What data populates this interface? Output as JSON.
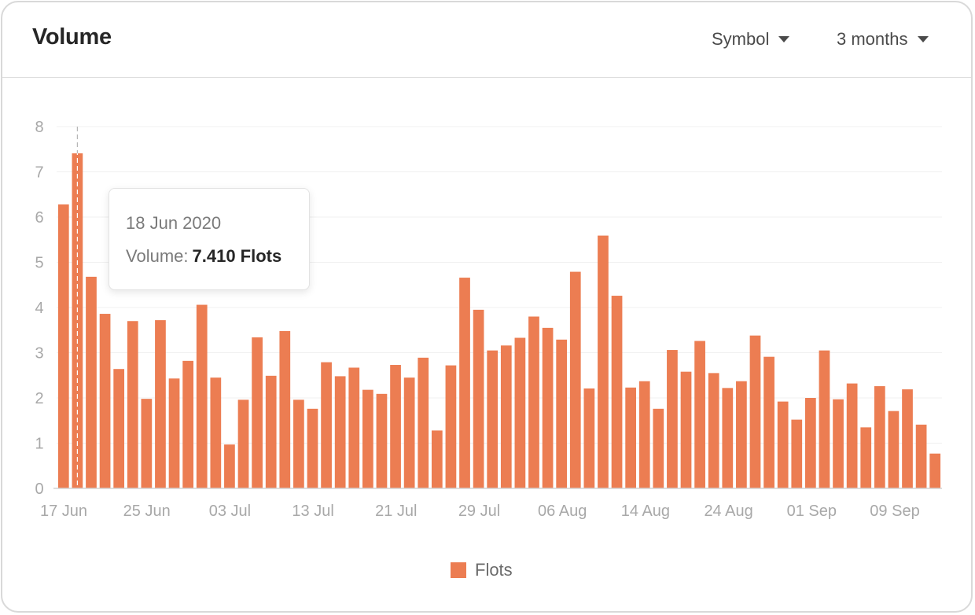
{
  "header": {
    "title": "Volume",
    "symbol_dropdown": "Symbol",
    "range_dropdown": "3 months"
  },
  "colors": {
    "bar": "#ec7d52",
    "grid": "#f0f0f0",
    "axis_text": "#a8a8a8"
  },
  "tooltip": {
    "date": "18 Jun 2020",
    "label": "Volume:",
    "value": "7.410 Flots"
  },
  "legend": {
    "label": "Flots"
  },
  "chart_data": {
    "type": "bar",
    "xlabel": "",
    "ylabel": "",
    "ylim": [
      0,
      8
    ],
    "y_ticks": [
      "0",
      "1",
      "2",
      "3",
      "4",
      "5",
      "6",
      "7",
      "8"
    ],
    "x_tick_labels": [
      "17 Jun",
      "25 Jun",
      "03 Jul",
      "13 Jul",
      "21 Jul",
      "29 Jul",
      "06 Aug",
      "14 Aug",
      "24 Aug",
      "01 Sep",
      "09 Sep"
    ],
    "grid": true,
    "legend_position": "bottom",
    "highlighted_bar": "18 Jun 2020",
    "series": [
      {
        "name": "Flots",
        "values": [
          6.28,
          7.41,
          4.68,
          3.86,
          2.64,
          3.7,
          1.98,
          3.72,
          2.43,
          2.82,
          4.06,
          2.45,
          0.97,
          1.96,
          3.34,
          2.49,
          3.48,
          1.96,
          1.76,
          2.79,
          2.48,
          2.67,
          2.18,
          2.09,
          2.73,
          2.45,
          2.89,
          1.28,
          2.72,
          4.66,
          3.95,
          3.05,
          3.16,
          3.33,
          3.8,
          3.55,
          3.29,
          4.79,
          2.21,
          5.59,
          4.26,
          2.23,
          2.37,
          1.76,
          3.06,
          2.58,
          3.26,
          2.55,
          2.22,
          2.37,
          3.38,
          2.91,
          1.92,
          1.52,
          2.0,
          3.05,
          1.97,
          2.32,
          1.35,
          2.26,
          1.71,
          2.19,
          1.41,
          0.77
        ]
      }
    ]
  }
}
